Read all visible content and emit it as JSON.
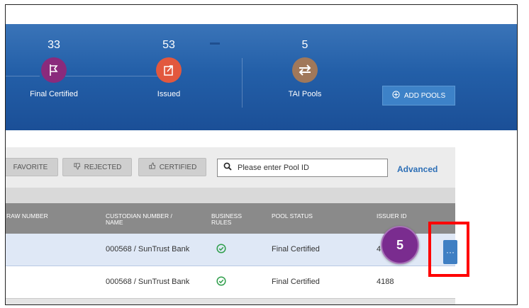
{
  "header": {
    "stats": [
      {
        "count": "33",
        "label": "Final Certified",
        "icon": "flag-icon",
        "color": "#8a2a7c"
      },
      {
        "count": "53",
        "label": "Issued",
        "icon": "issue-arrow-icon",
        "color": "#e2583e"
      },
      {
        "count": "5",
        "label": "TAI Pools",
        "icon": "transfer-arrows-icon",
        "color": "#a0785a"
      }
    ],
    "add_pools_label": "ADD POOLS"
  },
  "filters": {
    "favorite_label": "FAVORITE",
    "rejected_label": "REJECTED",
    "certified_label": "CERTIFIED",
    "search_placeholder": "Please enter Pool ID",
    "advanced_label": "Advanced"
  },
  "table": {
    "columns": {
      "draw_number": "RAW NUMBER",
      "custodian_line1": "CUSTODIAN NUMBER /",
      "custodian_line2": "NAME",
      "business_line1": "BUSINESS",
      "business_line2": "RULES",
      "pool_status": "POOL STATUS",
      "issuer_id": "ISSUER ID"
    },
    "rows": [
      {
        "custodian": "000568 / SunTrust Bank",
        "status": "Final Certified",
        "issuer_id": "4"
      },
      {
        "custodian": "000568 / SunTrust Bank",
        "status": "Final Certified",
        "issuer_id": "4188"
      }
    ]
  },
  "overlay": {
    "step_badge": "5",
    "more_button_label": "···"
  }
}
